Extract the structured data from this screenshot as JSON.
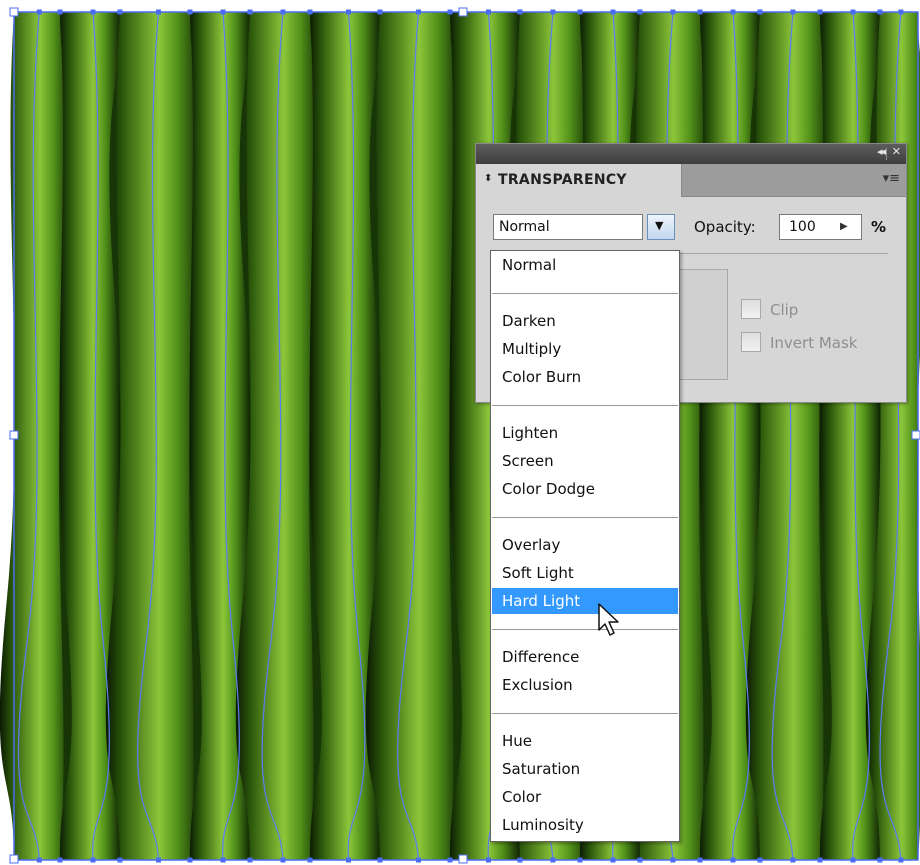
{
  "panel": {
    "title": "TRANSPARENCY",
    "tab_arrows": "⬍",
    "collapse_icon": "◂◂",
    "close_icon": "✕",
    "menu_icon": "▾≡",
    "blend_mode_value": "Normal",
    "opacity_label": "Opacity:",
    "opacity_value": "100",
    "opacity_unit": "%",
    "clip_label": "Clip",
    "invert_mask_label": "Invert Mask"
  },
  "blend_menu": {
    "items": [
      "Normal",
      "Darken",
      "Multiply",
      "Color Burn",
      "Lighten",
      "Screen",
      "Color Dodge",
      "Overlay",
      "Soft Light",
      "Hard Light",
      "Difference",
      "Exclusion",
      "Hue",
      "Saturation",
      "Color",
      "Luminosity"
    ],
    "selected": "Hard Light"
  },
  "colors": {
    "accent": "#3399ff",
    "artwork_green": "#6fa82a",
    "path_stroke": "#4a6cf0"
  }
}
